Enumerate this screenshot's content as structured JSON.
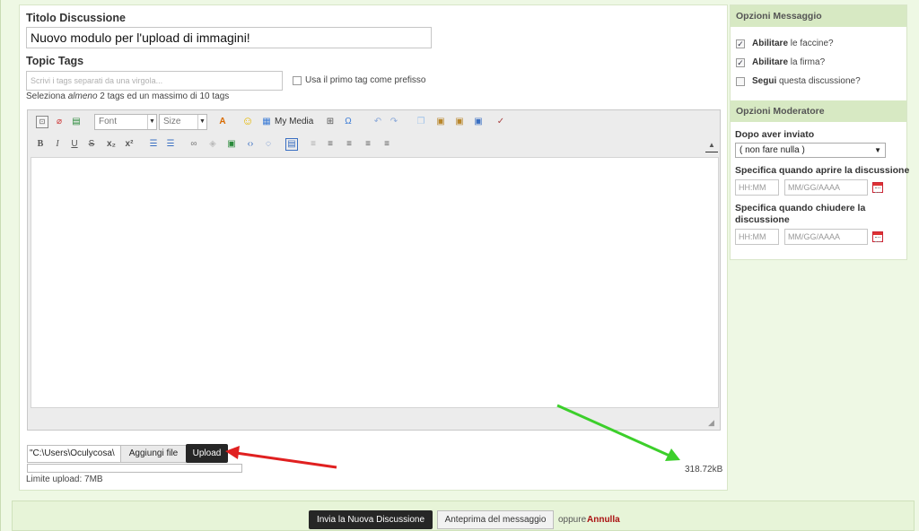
{
  "form": {
    "title_label": "Titolo Discussione",
    "title_value": "Nuovo modulo per l'upload di immagini!",
    "tags_label": "Topic Tags",
    "tags_placeholder": "Scrivi i tags separati da una virgola...",
    "tags_prefix_label": "Usa il primo tag come prefisso",
    "tags_hint_prefix": "Seleziona ",
    "tags_hint_em": "almeno",
    "tags_hint_suffix": " 2 tags ed un massimo di 10 tags"
  },
  "editor": {
    "font_label": "Font",
    "size_label": "Size",
    "my_media_label": "My Media",
    "toolbar1_icons": [
      "source-icon",
      "eraser-icon",
      "template-icon",
      "font-combo",
      "size-combo",
      "text-color-icon",
      "smiley-icon",
      "my-media-icon",
      "table-icon",
      "special-char-icon",
      "undo-icon",
      "redo-icon",
      "copy-icon",
      "paste-icon",
      "paste-text-icon",
      "paste-word-icon",
      "spellcheck-icon"
    ],
    "toolbar2_icons": [
      "bold-icon",
      "italic-icon",
      "underline-icon",
      "strike-icon",
      "subscript-icon",
      "superscript-icon",
      "ordered-list-icon",
      "unordered-list-icon",
      "link-icon",
      "unlink-icon",
      "image-icon",
      "code-icon",
      "quote-icon",
      "blockquote-icon",
      "align-left-icon",
      "align-center-icon",
      "align-right-icon",
      "justify-icon",
      "collapse-icon"
    ]
  },
  "upload": {
    "file_path": "\"C:\\Users\\Oculycosa\\",
    "browse_label": "Aggiungi file",
    "upload_label": "Upload",
    "limit_text": "Limite upload: 7MB",
    "file_size": "318.72kB",
    "progress_fraction": 0.0
  },
  "message_options": {
    "header": "Opzioni Messaggio",
    "items": [
      {
        "bold": "Abilitare",
        "rest": " le faccine?",
        "checked": true
      },
      {
        "bold": "Abilitare",
        "rest": " la firma?",
        "checked": true
      },
      {
        "bold": "Segui",
        "rest": " questa discussione?",
        "checked": false
      }
    ]
  },
  "moderator_options": {
    "header": "Opzioni Moderatore",
    "after_label": "Dopo aver inviato",
    "after_value": "( non fare nulla )",
    "open_label": "Specifica quando aprire la discussione",
    "close_label_1": "Specifica quando chiudere la",
    "close_label_2": "discussione",
    "time_placeholder": "HH:MM",
    "date_placeholder": "MM/GG/AAAA"
  },
  "actions": {
    "submit_label": "Invia la Nuova Discussione",
    "preview_label": "Anteprima del messaggio",
    "or_text": "oppure",
    "cancel_label": "Annulla"
  },
  "colors": {
    "annotation_red": "#e02020",
    "annotation_green": "#3ccf2b"
  }
}
